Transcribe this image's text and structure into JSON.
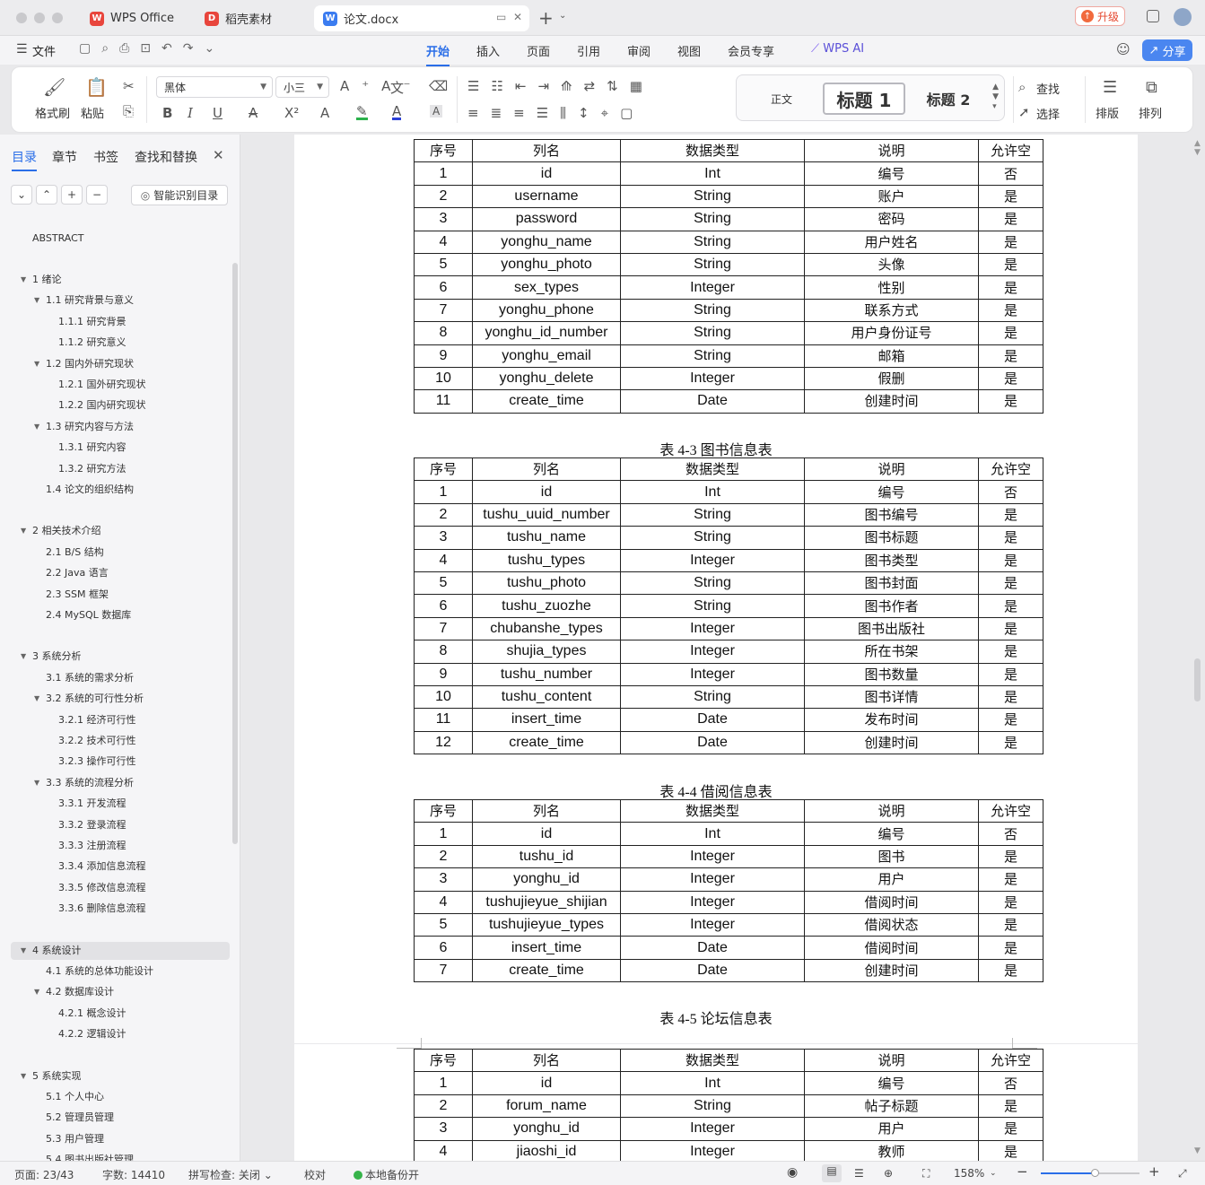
{
  "titlebar": {
    "tabs": [
      {
        "label": "WPS Office",
        "logo": "W",
        "color": "#e8453c"
      },
      {
        "label": "稻壳素材",
        "logo": "D",
        "color": "#e8453c"
      },
      {
        "label": "论文.docx",
        "logo": "W",
        "color": "#3b7cf0"
      }
    ],
    "upgrade": "升级"
  },
  "menubar": {
    "file": "文件",
    "tabs": [
      "开始",
      "插入",
      "页面",
      "引用",
      "审阅",
      "视图",
      "会员专享"
    ],
    "ai": "WPS AI",
    "share": "分享"
  },
  "ribbon": {
    "format_painter": "格式刷",
    "paste": "粘贴",
    "font_name": "黑体",
    "font_size": "小三",
    "styles": [
      "正文",
      "标题 1",
      "标题 2"
    ],
    "find": "查找",
    "select": "选择",
    "layout": "排版",
    "arrange": "排列"
  },
  "sidebar": {
    "tabs": [
      "目录",
      "章节",
      "书签",
      "查找和替换"
    ],
    "smart_toc": "智能识别目录",
    "toc": [
      {
        "label": "ABSTRACT",
        "level": 0,
        "arrow": false
      },
      {
        "label": "1 绪论",
        "level": 1,
        "arrow": true
      },
      {
        "label": "1.1 研究背景与意义",
        "level": 2,
        "arrow": true
      },
      {
        "label": "1.1.1 研究背景",
        "level": 3,
        "arrow": false
      },
      {
        "label": "1.1.2 研究意义",
        "level": 3,
        "arrow": false
      },
      {
        "label": "1.2 国内外研究现状",
        "level": 2,
        "arrow": true
      },
      {
        "label": "1.2.1 国外研究现状",
        "level": 3,
        "arrow": false
      },
      {
        "label": "1.2.2 国内研究现状",
        "level": 3,
        "arrow": false
      },
      {
        "label": "1.3 研究内容与方法",
        "level": 2,
        "arrow": true
      },
      {
        "label": "1.3.1 研究内容",
        "level": 3,
        "arrow": false
      },
      {
        "label": "1.3.2 研究方法",
        "level": 3,
        "arrow": false
      },
      {
        "label": "1.4 论文的组织结构",
        "level": 2,
        "arrow": false
      },
      {
        "label": "2 相关技术介绍",
        "level": 1,
        "arrow": true
      },
      {
        "label": "2.1 B/S 结构",
        "level": 2,
        "arrow": false
      },
      {
        "label": "2.2 Java 语言",
        "level": 2,
        "arrow": false
      },
      {
        "label": "2.3 SSM 框架",
        "level": 2,
        "arrow": false
      },
      {
        "label": "2.4 MySQL 数据库",
        "level": 2,
        "arrow": false
      },
      {
        "label": "3 系统分析",
        "level": 1,
        "arrow": true
      },
      {
        "label": "3.1 系统的需求分析",
        "level": 2,
        "arrow": false
      },
      {
        "label": "3.2 系统的可行性分析",
        "level": 2,
        "arrow": true
      },
      {
        "label": "3.2.1 经济可行性",
        "level": 3,
        "arrow": false
      },
      {
        "label": "3.2.2 技术可行性",
        "level": 3,
        "arrow": false
      },
      {
        "label": "3.2.3 操作可行性",
        "level": 3,
        "arrow": false
      },
      {
        "label": "3.3 系统的流程分析",
        "level": 2,
        "arrow": true
      },
      {
        "label": "3.3.1 开发流程",
        "level": 3,
        "arrow": false
      },
      {
        "label": "3.3.2 登录流程",
        "level": 3,
        "arrow": false
      },
      {
        "label": "3.3.3 注册流程",
        "level": 3,
        "arrow": false
      },
      {
        "label": "3.3.4 添加信息流程",
        "level": 3,
        "arrow": false
      },
      {
        "label": "3.3.5 修改信息流程",
        "level": 3,
        "arrow": false
      },
      {
        "label": "3.3.6 删除信息流程",
        "level": 3,
        "arrow": false
      },
      {
        "label": "4 系统设计",
        "level": 1,
        "arrow": true
      },
      {
        "label": "4.1 系统的总体功能设计",
        "level": 2,
        "arrow": false
      },
      {
        "label": "4.2 数据库设计",
        "level": 2,
        "arrow": true
      },
      {
        "label": "4.2.1 概念设计",
        "level": 3,
        "arrow": false
      },
      {
        "label": "4.2.2 逻辑设计",
        "level": 3,
        "arrow": false
      },
      {
        "label": "5 系统实现",
        "level": 1,
        "arrow": true
      },
      {
        "label": "5.1 个人中心",
        "level": 2,
        "arrow": false
      },
      {
        "label": "5.2 管理员管理",
        "level": 2,
        "arrow": false
      },
      {
        "label": "5.3 用户管理",
        "level": 2,
        "arrow": false
      },
      {
        "label": "5.4 图书出版社管理",
        "level": 2,
        "arrow": false
      }
    ]
  },
  "document": {
    "header": [
      "序号",
      "列名",
      "数据类型",
      "说明",
      "允许空"
    ],
    "tables": [
      {
        "caption": "",
        "rows": [
          [
            "1",
            "id",
            "Int",
            "编号",
            "否"
          ],
          [
            "2",
            "username",
            "String",
            "账户",
            "是"
          ],
          [
            "3",
            "password",
            "String",
            "密码",
            "是"
          ],
          [
            "4",
            "yonghu_name",
            "String",
            "用户姓名",
            "是"
          ],
          [
            "5",
            "yonghu_photo",
            "String",
            "头像",
            "是"
          ],
          [
            "6",
            "sex_types",
            "Integer",
            "性别",
            "是"
          ],
          [
            "7",
            "yonghu_phone",
            "String",
            "联系方式",
            "是"
          ],
          [
            "8",
            "yonghu_id_number",
            "String",
            "用户身份证号",
            "是"
          ],
          [
            "9",
            "yonghu_email",
            "String",
            "邮箱",
            "是"
          ],
          [
            "10",
            "yonghu_delete",
            "Integer",
            "假删",
            "是"
          ],
          [
            "11",
            "create_time",
            "Date",
            "创建时间",
            "是"
          ]
        ]
      },
      {
        "caption": "表 4-3 图书信息表",
        "rows": [
          [
            "1",
            "id",
            "Int",
            "编号",
            "否"
          ],
          [
            "2",
            "tushu_uuid_number",
            "String",
            "图书编号",
            "是"
          ],
          [
            "3",
            "tushu_name",
            "String",
            "图书标题",
            "是"
          ],
          [
            "4",
            "tushu_types",
            "Integer",
            "图书类型",
            "是"
          ],
          [
            "5",
            "tushu_photo",
            "String",
            "图书封面",
            "是"
          ],
          [
            "6",
            "tushu_zuozhe",
            "String",
            "图书作者",
            "是"
          ],
          [
            "7",
            "chubanshe_types",
            "Integer",
            "图书出版社",
            "是"
          ],
          [
            "8",
            "shujia_types",
            "Integer",
            "所在书架",
            "是"
          ],
          [
            "9",
            "tushu_number",
            "Integer",
            "图书数量",
            "是"
          ],
          [
            "10",
            "tushu_content",
            "String",
            "图书详情",
            "是"
          ],
          [
            "11",
            "insert_time",
            "Date",
            "发布时间",
            "是"
          ],
          [
            "12",
            "create_time",
            "Date",
            "创建时间",
            "是"
          ]
        ]
      },
      {
        "caption": "表 4-4 借阅信息表",
        "rows": [
          [
            "1",
            "id",
            "Int",
            "编号",
            "否"
          ],
          [
            "2",
            "tushu_id",
            "Integer",
            "图书",
            "是"
          ],
          [
            "3",
            "yonghu_id",
            "Integer",
            "用户",
            "是"
          ],
          [
            "4",
            "tushujieyue_shijian",
            "Integer",
            "借阅时间",
            "是"
          ],
          [
            "5",
            "tushujieyue_types",
            "Integer",
            "借阅状态",
            "是"
          ],
          [
            "6",
            "insert_time",
            "Date",
            "借阅时间",
            "是"
          ],
          [
            "7",
            "create_time",
            "Date",
            "创建时间",
            "是"
          ]
        ]
      },
      {
        "caption": "表 4-5 论坛信息表",
        "rows": [
          [
            "1",
            "id",
            "Int",
            "编号",
            "否"
          ],
          [
            "2",
            "forum_name",
            "String",
            "帖子标题",
            "是"
          ],
          [
            "3",
            "yonghu_id",
            "Integer",
            "用户",
            "是"
          ],
          [
            "4",
            "jiaoshi_id",
            "Integer",
            "教师",
            "是"
          ]
        ]
      }
    ]
  },
  "statusbar": {
    "page": "页面: 23/43",
    "words": "字数: 14410",
    "spell": "拼写检查: 关闭",
    "proof": "校对",
    "backup": "本地备份开",
    "zoom": "158%",
    "zoom_level": 0.55
  }
}
